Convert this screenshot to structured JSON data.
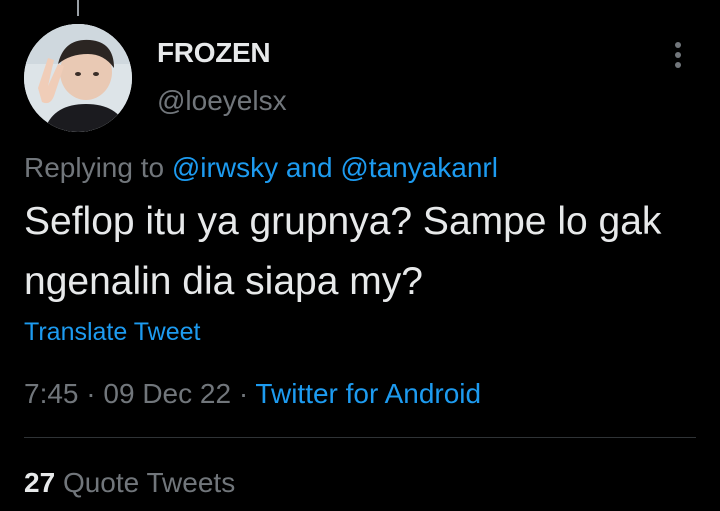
{
  "author": {
    "display_name": "FROZEN",
    "handle": "@loeyelsx"
  },
  "reply": {
    "prefix": "Replying to",
    "mention1": "@irwsky",
    "conjunction": "and",
    "mention2": "@tanyakanrl"
  },
  "tweet": {
    "text": "Seflop itu ya grupnya? Sampe lo gak ngenalin dia siapa my?",
    "translate_label": "Translate Tweet",
    "time": "7:45",
    "date": "09 Dec 22",
    "separator": "·",
    "source": "Twitter for Android"
  },
  "stats": {
    "quote_count": "27",
    "quote_label": "Quote Tweets"
  },
  "colors": {
    "background": "#000000",
    "text": "#e7e9ea",
    "muted": "#71767b",
    "link": "#1d9bf0",
    "divider": "#2f3336"
  },
  "icons": {
    "more": "more-vertical-icon",
    "avatar": "user-avatar"
  }
}
